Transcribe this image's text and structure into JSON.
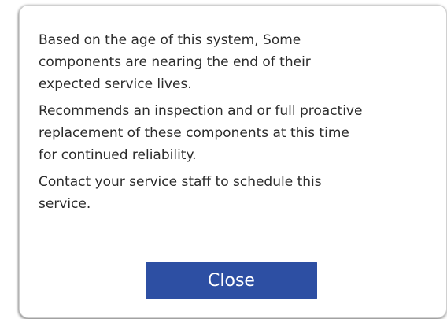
{
  "dialog": {
    "paragraphs": [
      "Based on the age of this system, Some\ncomponents are nearing the end of their\nexpected service lives.",
      "Recommends an inspection and or full proactive\nreplacement of these components  at this time\nfor continued reliability.",
      "Contact your service staff to schedule this\nservice."
    ],
    "close_label": "Close"
  },
  "colors": {
    "button_background": "#2d4fa3",
    "button_text": "#ffffff",
    "message_text": "#2b2b2b",
    "dialog_background": "#ffffff"
  }
}
